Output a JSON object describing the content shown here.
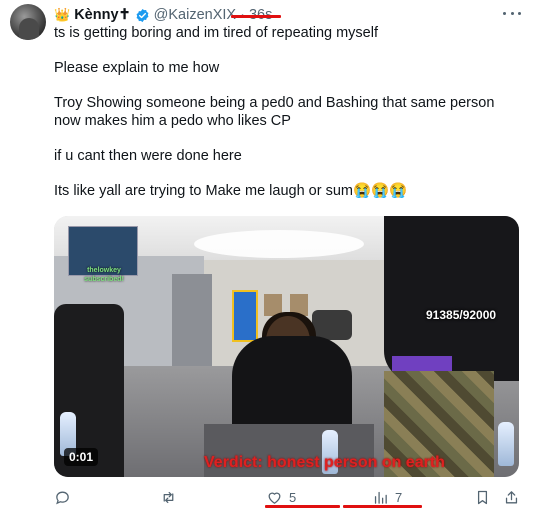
{
  "tweet": {
    "display_name": "Kènny✝",
    "name_emoji": "👑",
    "handle": "@KaizenXIX",
    "separator": "·",
    "time": "36s",
    "body": [
      "ts is getting boring and im tired of repeating myself",
      "Please explain to me how",
      "Troy Showing someone being a ped0 and Bashing that same person now makes him a pedo who likes CP",
      "if u cant then were done here",
      "Its like yall are trying to Make me laugh or sum😭😭😭"
    ]
  },
  "media": {
    "pip_label": "thelowkey subscribed!",
    "overlay_count": "91385/92000",
    "timestamp": "0:01",
    "caption": "Verdict: honest person on earth"
  },
  "actions": {
    "likes": "5",
    "views": "7"
  },
  "colors": {
    "verified": "#1d9bf0",
    "muted_text": "#536471",
    "annotation": "#e01010"
  }
}
